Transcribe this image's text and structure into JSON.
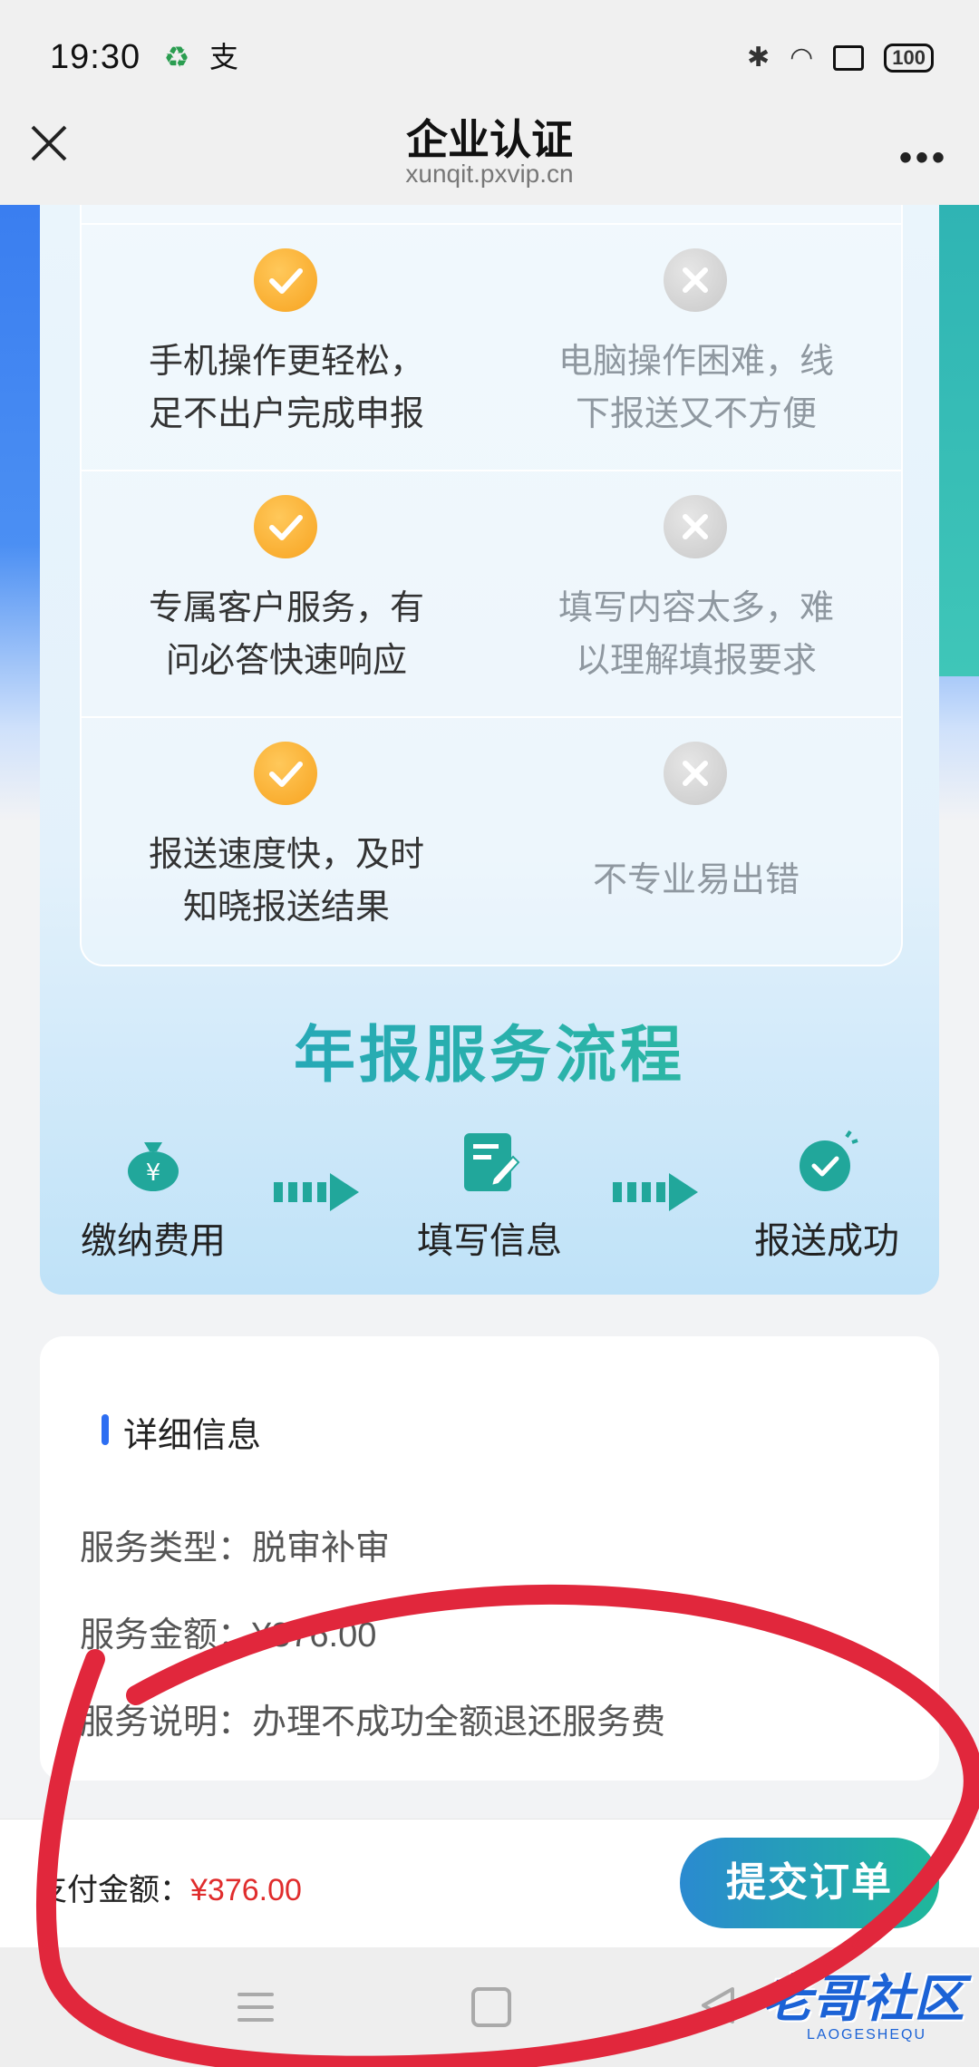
{
  "status_bar": {
    "time": "19:30",
    "battery": "100"
  },
  "header": {
    "title": "企业认证",
    "url": "xunqit.pxvip.cn"
  },
  "comparison": [
    {
      "good": "手机操作更轻松，\n足不出户完成申报",
      "bad": "电脑操作困难，线\n下报送又不方便"
    },
    {
      "good": "专属客户服务，有\n问必答快速响应",
      "bad": "填写内容太多，难\n以理解填报要求"
    },
    {
      "good": "报送速度快，及时\n知晓报送结果",
      "bad": "不专业易出错"
    }
  ],
  "process": {
    "title": "年报服务流程",
    "steps": [
      "缴纳费用",
      "填写信息",
      "报送成功"
    ]
  },
  "details": {
    "heading": "详细信息",
    "service_type": "服务类型：脱审补审",
    "service_amount": "服务金额：¥376.00",
    "service_note": "服务说明：办理不成功全额退还服务费"
  },
  "bottom": {
    "pay_label": "支付金额：",
    "pay_amount": "¥376.00",
    "submit": "提交订单"
  },
  "watermark": {
    "text": "老哥社区",
    "sub": "LAOGESHEQU"
  },
  "colors": {
    "accent_blue": "#2d6ef2",
    "price_red": "#e02d2d",
    "check_orange": "#f7a320",
    "scribble_red": "#e1273c"
  }
}
